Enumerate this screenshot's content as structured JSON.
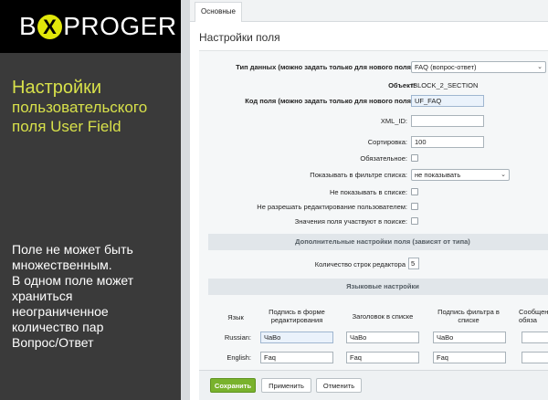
{
  "brand": {
    "logo_pre": "B",
    "logo_x": "X",
    "logo_post": "PROGER",
    "accent": "#e2e80a"
  },
  "promo": {
    "title_line1": "Настройки",
    "title_line2": "пользовательского",
    "title_line3": "поля User Field",
    "body_lines": [
      "Поле не может быть",
      "множественным.",
      "В одном поле может",
      "храниться",
      "неограниченное",
      "количество пар",
      "Вопрос/Ответ"
    ]
  },
  "tabs": {
    "main": "Основные"
  },
  "page": {
    "title": "Настройки поля"
  },
  "form": {
    "data_type_label": "Тип данных (можно задать только для нового поля):",
    "data_type_value": "FAQ (вопрос-ответ)",
    "object_label": "Объект:",
    "object_value": "IBLOCK_2_SECTION",
    "field_code_label": "Код поля (можно задать только для нового поля):",
    "field_code_value": "UF_FAQ",
    "xml_id_label": "XML_ID:",
    "xml_id_value": "",
    "sort_label": "Сортировка:",
    "sort_value": "100",
    "required_label": "Обязательное:",
    "filter_label": "Показывать в фильтре списка:",
    "filter_value": "не показывать",
    "hide_list_label": "Не показывать в списке:",
    "no_edit_label": "Не разрешать редактирование пользователем:",
    "search_label": "Значения поля участвуют в поиске:"
  },
  "additional": {
    "section_title": "Дополнительные настройки поля (зависят от типа)",
    "rows_label": "Количество строк редактора",
    "rows_value": "5"
  },
  "lang": {
    "section_title": "Языковые настройки",
    "headers": [
      "Язык",
      "Подпись в форме редактирования",
      "Заголовок в списке",
      "Подпись фильтра в списке",
      "Сообщение обяза"
    ],
    "rows": [
      {
        "lang": "Russian:",
        "values": [
          "ЧаВо",
          "ЧаВо",
          "ЧаВо",
          ""
        ]
      },
      {
        "lang": "English:",
        "values": [
          "Faq",
          "Faq",
          "Faq",
          ""
        ]
      }
    ]
  },
  "buttons": {
    "save": "Сохранить",
    "apply": "Применить",
    "cancel": "Отменить"
  }
}
